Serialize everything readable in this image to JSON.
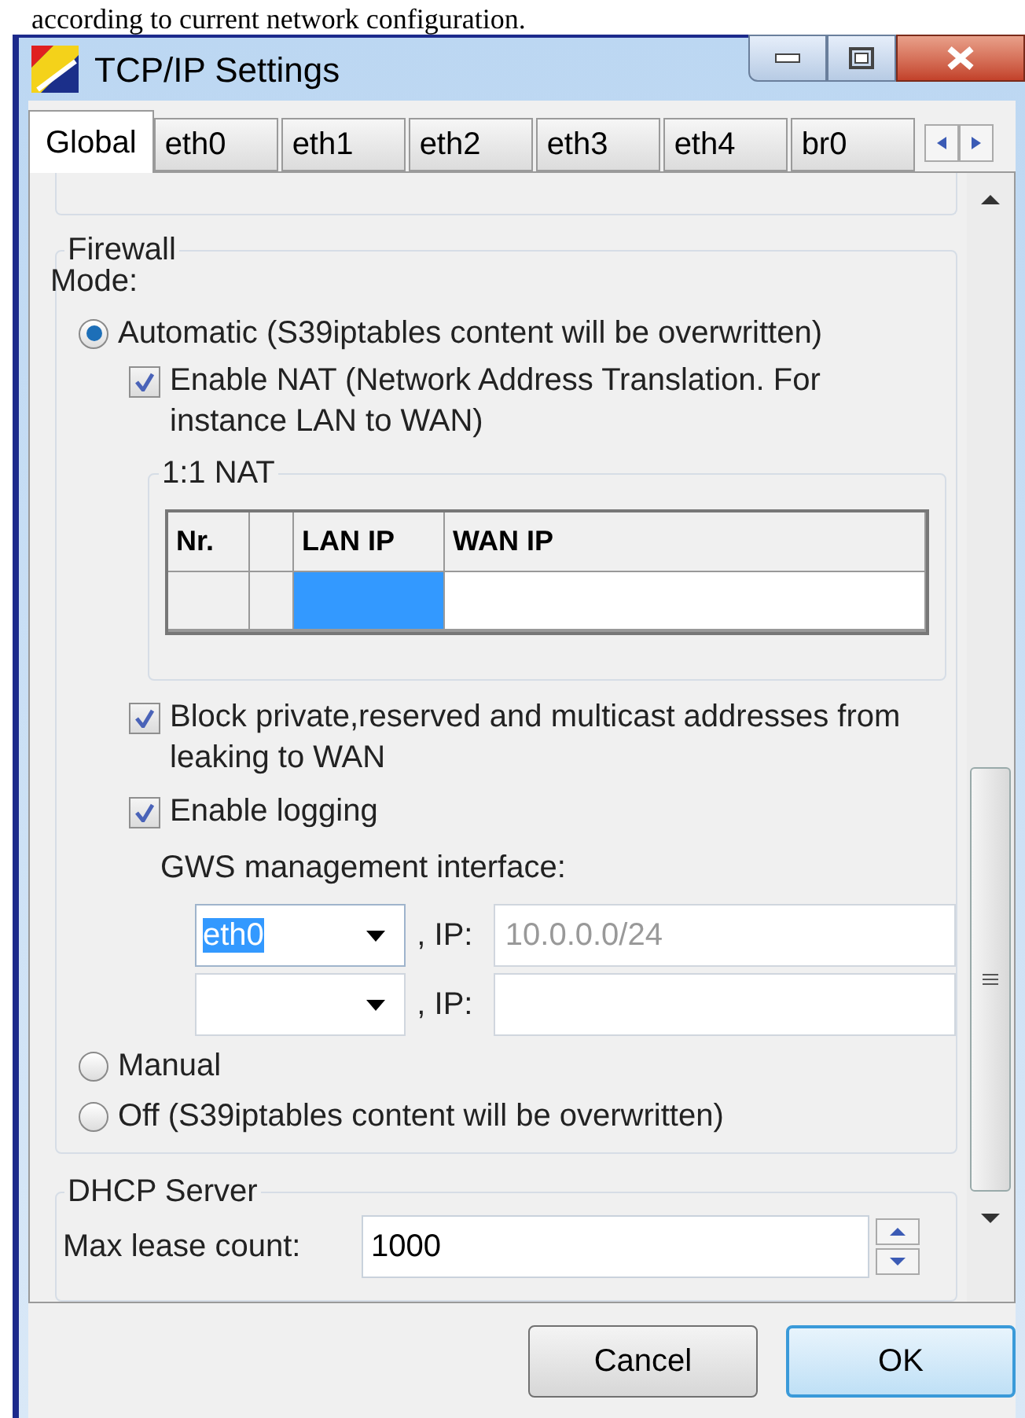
{
  "page_text": "according to current network configuration.",
  "window": {
    "title": "TCP/IP Settings"
  },
  "tabs": [
    {
      "label": "Global",
      "selected": true
    },
    {
      "label": "eth0",
      "selected": false
    },
    {
      "label": "eth1",
      "selected": false
    },
    {
      "label": "eth2",
      "selected": false
    },
    {
      "label": "eth3",
      "selected": false
    },
    {
      "label": "eth4",
      "selected": false
    },
    {
      "label": "br0",
      "selected": false
    }
  ],
  "firewall": {
    "title": "Firewall",
    "mode_label": "Mode:",
    "modes": [
      {
        "label": "Automatic (S39iptables content will be overwritten)",
        "selected": true
      },
      {
        "label": "Manual",
        "selected": false
      },
      {
        "label": "Off (S39iptables content will be overwritten)",
        "selected": false
      }
    ],
    "enable_nat": {
      "label": "Enable NAT (Network Address Translation. For instance LAN to WAN)",
      "checked": true
    },
    "nat_table": {
      "title": "1:1 NAT",
      "columns": [
        {
          "kind": "text",
          "label": "Nr."
        },
        {
          "kind": "blank"
        },
        {
          "kind": "text",
          "label": "LAN IP"
        },
        {
          "kind": "text",
          "label": "WAN IP"
        }
      ],
      "row": [
        {
          "selected": false
        },
        {
          "selected": false
        },
        {
          "selected": true
        },
        {
          "selected": false
        }
      ]
    },
    "block_private": {
      "label": "Block private,reserved and multicast addresses from leaking to WAN",
      "checked": true
    },
    "enable_logging": {
      "label": "Enable logging",
      "checked": true
    },
    "gws_label": "GWS management interface:",
    "interfaces": [
      {
        "value": "eth0",
        "focused": true,
        "ip_label": ", IP:",
        "ip_placeholder": "10.0.0.0/24"
      },
      {
        "focused": false,
        "ip_label": ", IP:"
      }
    ]
  },
  "dhcp": {
    "title": "DHCP Server",
    "label": "Max lease count:",
    "value": "1000"
  },
  "buttons": [
    {
      "label": "Cancel",
      "default": false
    },
    {
      "label": "OK",
      "default": true
    }
  ]
}
